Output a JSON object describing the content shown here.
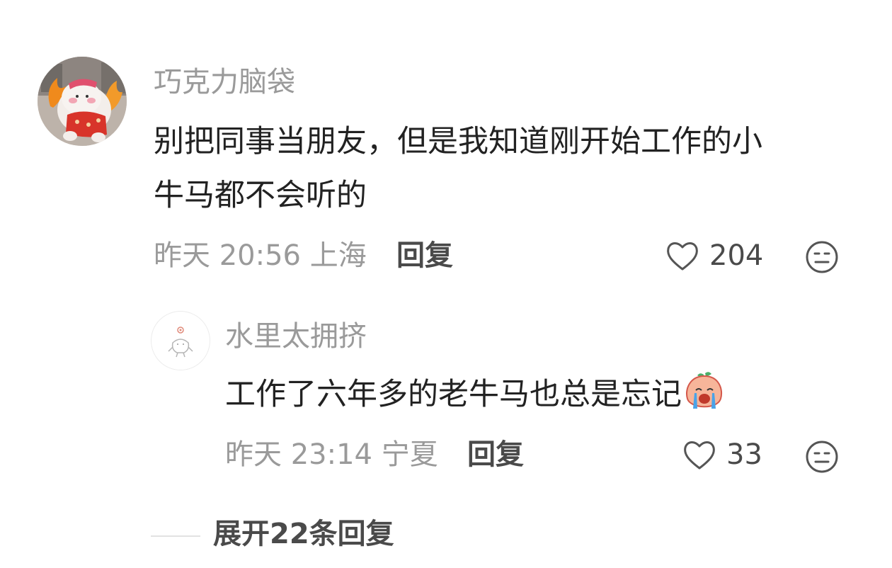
{
  "comment": {
    "username": "巧克力脑袋",
    "content_line1": "别把同事当朋友，但是我知道刚开始工作的小",
    "content_line2": "牛马都不会听的",
    "time": "昨天 20:56 上海",
    "reply_label": "回复",
    "like_count": "204",
    "like_icon": "heart-outline-icon",
    "emoji_icon": "meh-face-icon"
  },
  "reply": {
    "username": "水里太拥挤",
    "content": "工作了六年多的老牛马也总是忘记",
    "sticker": "crying-peach-sticker",
    "time": "昨天 23:14 宁夏",
    "reply_label": "回复",
    "like_count": "33",
    "like_icon": "heart-outline-icon",
    "emoji_icon": "meh-face-icon"
  },
  "expand": {
    "label": "展开22条回复"
  },
  "colors": {
    "text_primary": "#222222",
    "text_secondary": "#9a9a9a",
    "text_action": "#4a4a4a"
  }
}
